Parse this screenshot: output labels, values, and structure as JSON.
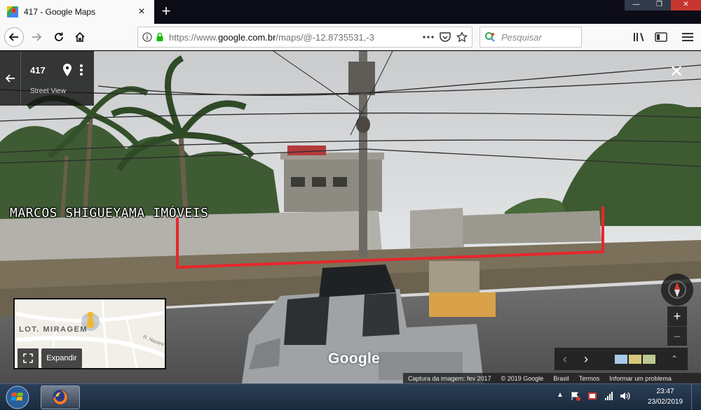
{
  "browser": {
    "tab_title": "417 - Google Maps",
    "new_tab_label": "+",
    "url_prefix": "https://www.",
    "url_domain": "google.com.br",
    "url_rest": "/maps/@-12.8735531,-3",
    "search_placeholder": "Pesquisar"
  },
  "streetview": {
    "place_title": "417",
    "place_subtitle": "Street View",
    "close_label": "✕",
    "watermark": "MARCOS SHIGUEYAMA IMÓVEIS",
    "minimap": {
      "label": "LOT. MIRAGEM",
      "street_label": "R. Nazaré",
      "expand_label": "Expandir"
    },
    "zoom_in_label": "+",
    "zoom_out_label": "−",
    "timeline": {
      "prev_label": "‹",
      "next_label": "›",
      "expand_label": "⌃",
      "thumb_colors": [
        "#a9c9e8",
        "#d8c77a",
        "#b9c98f"
      ]
    },
    "google_logo": "Google",
    "footer": {
      "capture": "Captura da imagem: fev 2017",
      "copyright": "© 2019 Google",
      "country": "Brasil",
      "terms": "Termos",
      "report": "Informar um problema"
    }
  },
  "taskbar": {
    "time": "23:47",
    "date": "23/02/2019",
    "tray_arrow": "▲"
  },
  "colors": {
    "highlight_line": "#e8262b",
    "tab_bg": "#f9f9fa",
    "chrome_dark": "#0c0c17"
  }
}
